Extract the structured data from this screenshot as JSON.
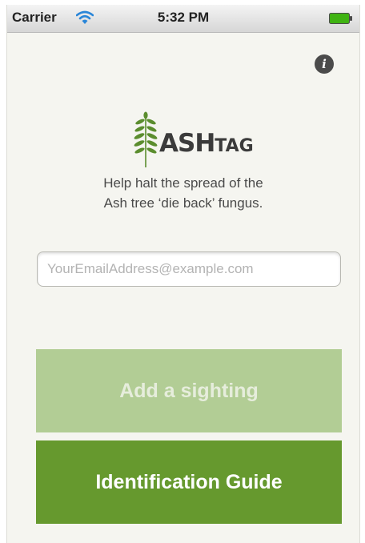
{
  "status_bar": {
    "carrier": "Carrier",
    "wifi_icon": "wifi-icon",
    "time": "5:32 PM",
    "battery_icon": "battery-icon",
    "battery_color": "#3fb312"
  },
  "header": {
    "info_icon": "info-icon"
  },
  "logo": {
    "icon": "ash-leaf-icon",
    "text_big": "ASH",
    "text_small": "TAG",
    "brand_color": "#5b8d2e"
  },
  "tagline": {
    "line1": "Help halt the spread of the",
    "line2": "Ash tree ‘die back’ fungus."
  },
  "email": {
    "value": "",
    "placeholder": "YourEmailAddress@example.com"
  },
  "buttons": {
    "add_sighting": "Add a sighting",
    "add_sighting_color": "#b2cd95",
    "identification_guide": "Identification Guide",
    "identification_guide_color": "#66992e"
  }
}
